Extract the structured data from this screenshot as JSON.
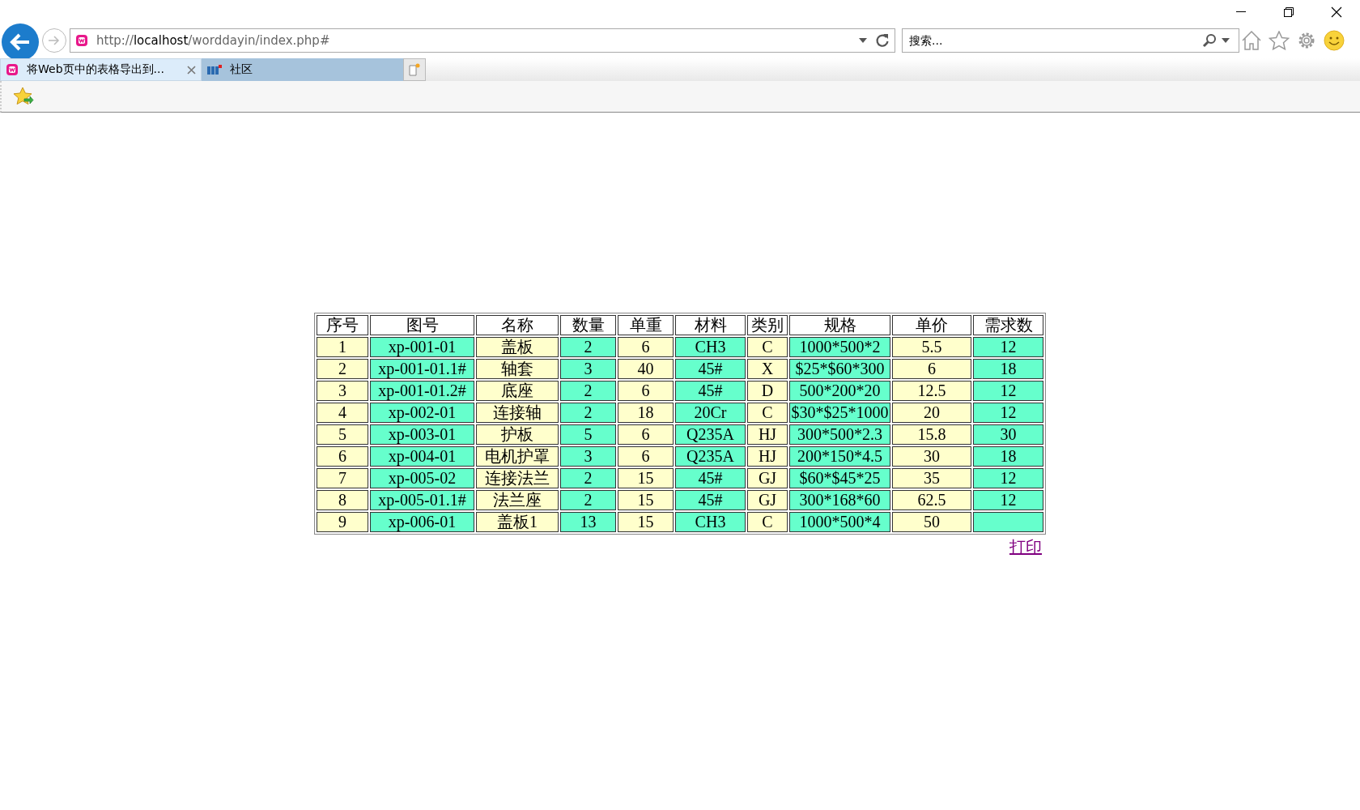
{
  "address_bar": {
    "url": "http://**localhost**/worddayin/index.php#"
  },
  "search": {
    "placeholder": "搜索..."
  },
  "tabs": [
    {
      "label": "将Web页中的表格导出到...",
      "selected": true,
      "kind": "local"
    },
    {
      "label": "社区",
      "selected": false,
      "kind": "site"
    }
  ],
  "table": {
    "columns": [
      "序号",
      "图号",
      "名称",
      "数量",
      "单重",
      "材料",
      "类别",
      "规格",
      "单价",
      "需求数"
    ],
    "rows": [
      [
        "1",
        "xp-001-01",
        "盖板",
        "2",
        "6",
        "CH3",
        "C",
        "1000*500*2",
        "5.5",
        "12"
      ],
      [
        "2",
        "xp-001-01.1#",
        "轴套",
        "3",
        "40",
        "45#",
        "X",
        "$25*$60*300",
        "6",
        "18"
      ],
      [
        "3",
        "xp-001-01.2#",
        "底座",
        "2",
        "6",
        "45#",
        "D",
        "500*200*20",
        "12.5",
        "12"
      ],
      [
        "4",
        "xp-002-01",
        "连接轴",
        "2",
        "18",
        "20Cr",
        "C",
        "$30*$25*1000",
        "20",
        "12"
      ],
      [
        "5",
        "xp-003-01",
        "护板",
        "5",
        "6",
        "Q235A",
        "HJ",
        "300*500*2.3",
        "15.8",
        "30"
      ],
      [
        "6",
        "xp-004-01",
        "电机护罩",
        "3",
        "6",
        "Q235A",
        "HJ",
        "200*150*4.5",
        "30",
        "18"
      ],
      [
        "7",
        "xp-005-02",
        "连接法兰",
        "2",
        "15",
        "45#",
        "GJ",
        "$60*$45*25",
        "35",
        "12"
      ],
      [
        "8",
        "xp-005-01.1#",
        "法兰座",
        "2",
        "15",
        "45#",
        "GJ",
        "300*168*60",
        "62.5",
        "12"
      ],
      [
        "9",
        "xp-006-01",
        "盖板1",
        "13",
        "15",
        "CH3",
        "C",
        "1000*500*4",
        "50"
      ]
    ]
  },
  "print_link": "打印"
}
